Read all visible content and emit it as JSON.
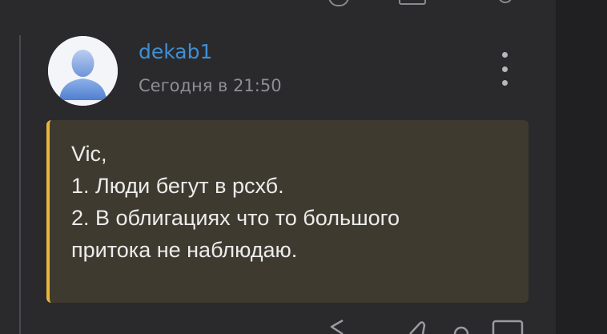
{
  "post": {
    "author": "dekab1",
    "timestamp": "Сегодня в 21:50",
    "avatar_icon": "default-user-avatar-icon",
    "menu_icon": "more-vertical-icon",
    "quote_lines": [
      "Vic,",
      "1. Люди бегут в рсхб.",
      "2. В облигациях что то большого",
      "притока не наблюдаю."
    ]
  },
  "actions": {
    "icons": [
      "reply-icon",
      "like-icon",
      "comment-icon"
    ]
  },
  "colors": {
    "background": "#2a2a2d",
    "username": "#3f8fd6",
    "timestamp": "#8e8e93",
    "quote_background": "#3f3a2f",
    "quote_accent": "#e9b63a",
    "text": "#ececec"
  }
}
